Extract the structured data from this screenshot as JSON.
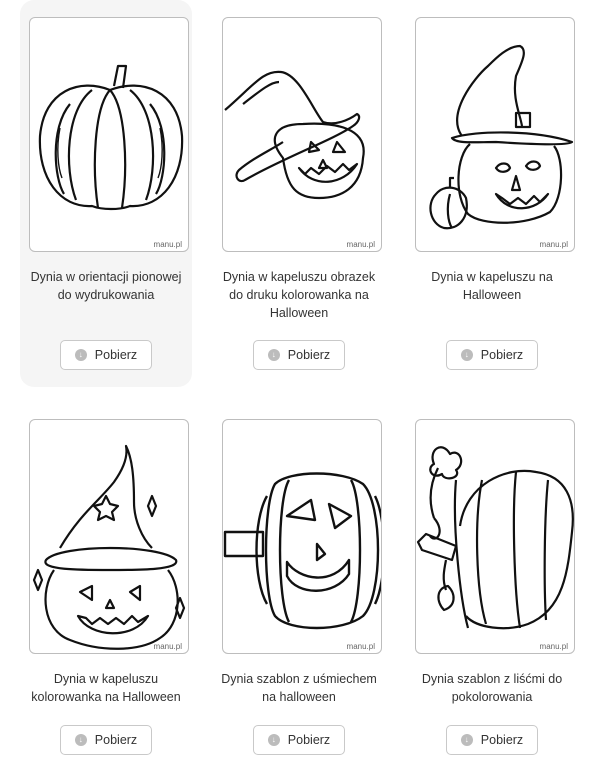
{
  "cards": [
    {
      "title": "Dynia w orientacji pionowej do wydrukowania",
      "button": "Pobierz",
      "watermark": "manu.pl"
    },
    {
      "title": "Dynia w kapeluszu obrazek do druku kolorowanka na Halloween",
      "button": "Pobierz",
      "watermark": "manu.pl"
    },
    {
      "title": "Dynia w kapeluszu na Halloween",
      "button": "Pobierz",
      "watermark": "manu.pl"
    },
    {
      "title": "Dynia w kapeluszu kolorowanka na Halloween",
      "button": "Pobierz",
      "watermark": "manu.pl"
    },
    {
      "title": "Dynia szablon z uśmiechem na halloween",
      "button": "Pobierz",
      "watermark": "manu.pl"
    },
    {
      "title": "Dynia szablon z liśćmi do pokolorowania",
      "button": "Pobierz",
      "watermark": "manu.pl"
    }
  ],
  "icons": {
    "download": "download-icon"
  },
  "colors": {
    "hover_bg": "#f5f5f5",
    "border": "#bdbdbd"
  }
}
